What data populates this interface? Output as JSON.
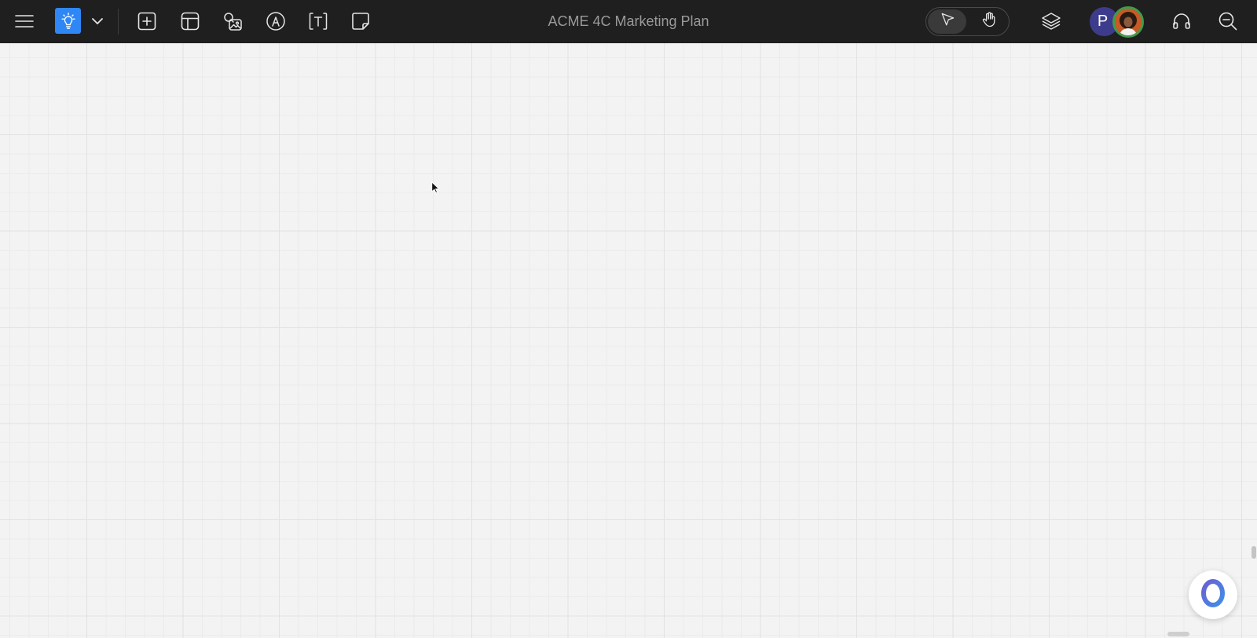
{
  "app": {
    "document_title": "ACME 4C Marketing Plan"
  },
  "toolbar": {
    "menu_icon": "hamburger-menu-icon",
    "brand_icon": "lightbulb-icon",
    "brand_dropdown_icon": "chevron-down-icon",
    "tools": [
      {
        "name": "add-element",
        "icon": "plus-square-icon"
      },
      {
        "name": "templates",
        "icon": "layout-template-icon"
      },
      {
        "name": "media",
        "icon": "image-search-icon"
      },
      {
        "name": "draw",
        "icon": "pen-nib-icon"
      },
      {
        "name": "text",
        "icon": "text-box-icon"
      },
      {
        "name": "sticky-note",
        "icon": "sticky-note-icon"
      }
    ]
  },
  "mode_toggle": {
    "active": "select",
    "options": [
      "select",
      "pan"
    ]
  },
  "collaborators": {
    "initial_avatar": "P",
    "photo_avatar_status": "online"
  },
  "right_tools": [
    "layers-icon",
    "headphones-icon",
    "zoom-out-icon"
  ],
  "colors": {
    "topbar": "#1f1f1f",
    "brand_accent": "#2f86f5",
    "canvas": "#f3f3f3",
    "avatar_initial_bg": "#3d3c8c",
    "avatar_ring": "#3e9b4e",
    "assistant_ring_start": "#6b5fd3",
    "assistant_ring_end": "#3f8fe6"
  }
}
